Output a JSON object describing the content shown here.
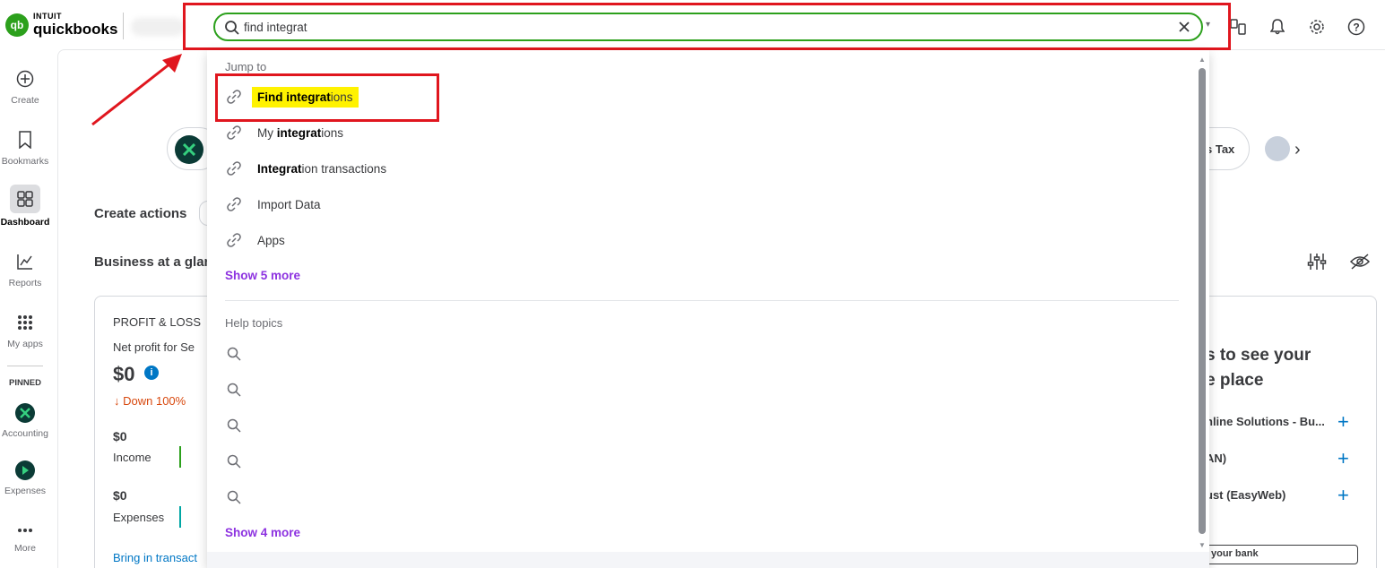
{
  "brand": {
    "intuit": "INTUIT",
    "quickbooks": "quickbooks",
    "logo_mark": "qb"
  },
  "search": {
    "value": "find integrat",
    "placeholder": ""
  },
  "leftnav": {
    "items": [
      {
        "label": "Create",
        "icon": "plus-circle-icon"
      },
      {
        "label": "Bookmarks",
        "icon": "bookmark-icon"
      },
      {
        "label": "Dashboard",
        "icon": "dashboard-icon",
        "active": true
      },
      {
        "label": "Reports",
        "icon": "reports-icon"
      },
      {
        "label": "My apps",
        "icon": "apps-grid-icon"
      }
    ],
    "pinned_label": "PINNED",
    "pinned": [
      {
        "label": "Accounting",
        "icon": "accounting-icon"
      },
      {
        "label": "Expenses",
        "icon": "expenses-icon"
      }
    ],
    "more_label": "More"
  },
  "dropdown": {
    "jump_to_label": "Jump to",
    "jump_items": [
      {
        "bold": "Find integrat",
        "rest": "ions"
      },
      {
        "prefix": "My ",
        "bold": "integrat",
        "rest": "ions"
      },
      {
        "bold": "Integrat",
        "rest": "ion transactions"
      },
      {
        "prefix": "Import Data"
      },
      {
        "prefix": "Apps"
      }
    ],
    "show_more_jump": "Show 5 more",
    "help_topics_label": "Help topics",
    "show_more_help": "Show 4 more"
  },
  "main": {
    "create_actions": "Create actions",
    "business_glance": "Business at a glan",
    "chip_right_text": "s Tax",
    "pl": {
      "title": "PROFIT & LOSS",
      "subtitle": "Net profit for Se",
      "amount": "$0",
      "trend": "Down 100%",
      "income_amount": "$0",
      "income_label": "Income",
      "expenses_amount": "$0",
      "expenses_label": "Expenses",
      "bring_in": "Bring in transact"
    },
    "bank_panel": {
      "heading_line1": "s to see your",
      "heading_line2": "e place",
      "rows": [
        "nline Solutions - Bu...",
        "AN)",
        "ust (EasyWeb)"
      ],
      "button": "your bank"
    }
  },
  "colors": {
    "accent_green": "#2ca01c",
    "annotation_red": "#e0161e",
    "highlight_yellow": "#fff200",
    "show_more_purple": "#8d32e0",
    "link_blue": "#0077c5"
  }
}
